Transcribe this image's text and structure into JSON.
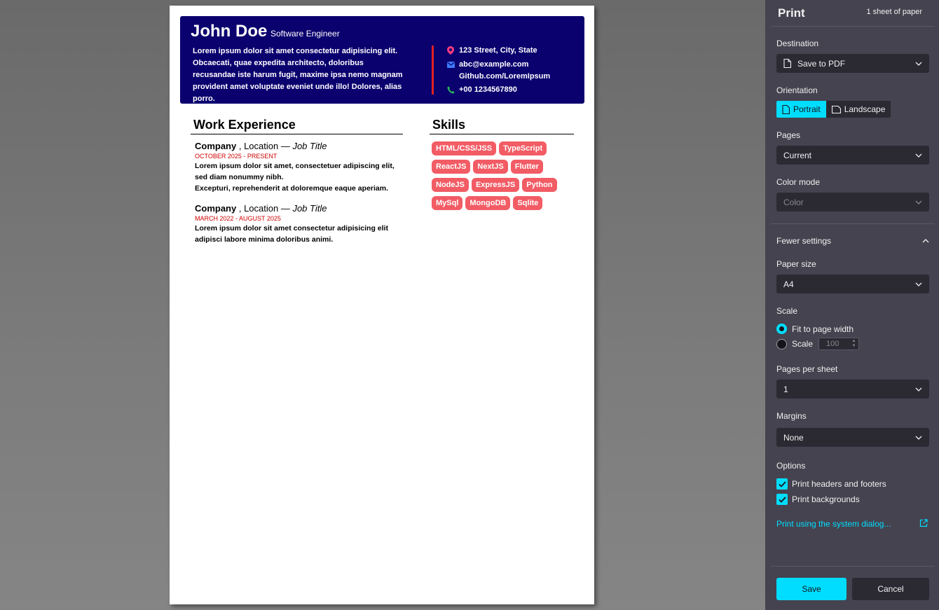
{
  "resume": {
    "name": "John Doe",
    "role": "Software Engineer",
    "summary": "Lorem ipsum dolor sit amet consectetur adipisicing elit. Obcaecati, quae expedita architecto, doloribus recusandae iste harum fugit, maxime ipsa nemo magnam provident amet voluptate eveniet unde illo! Dolores, alias porro.",
    "contact": {
      "address": "123 Street, City, State",
      "email": "abc@example.com",
      "github": "Github.com/LoremIpsum",
      "phone": "+00 1234567890"
    },
    "work_title": "Work Experience",
    "skills_title": "Skills",
    "jobs": [
      {
        "company": "Company",
        "location": " , Location — ",
        "title": "Job Title",
        "dates": "OCTOBER 2025 - PRESENT",
        "desc1": "Lorem ipsum dolor sit amet, consectetuer adipiscing elit, sed diam nonummy nibh.",
        "desc2": "Excepturi, reprehenderit at doloremque eaque aperiam."
      },
      {
        "company": "Company",
        "location": " , Location — ",
        "title": "Job Title",
        "dates": "MARCH 2022 - AUGUST 2025",
        "desc1": "Lorem ipsum dolor sit amet consectetur adipisicing elit adipisci labore minima doloribus animi."
      }
    ],
    "skills": [
      "HTML/CSS/JSS",
      "TypeScript",
      "ReactJS",
      "NextJS",
      "Flutter",
      "NodeJS",
      "ExpressJS",
      "Python",
      "MySql",
      "MongoDB",
      "Sqlite"
    ]
  },
  "print": {
    "title": "Print",
    "sheets": "1 sheet of paper",
    "destination_label": "Destination",
    "destination_value": "Save to PDF",
    "orientation_label": "Orientation",
    "portrait": "Portrait",
    "landscape": "Landscape",
    "pages_label": "Pages",
    "pages_value": "Current",
    "color_label": "Color mode",
    "color_value": "Color",
    "fewer_settings": "Fewer settings",
    "paper_label": "Paper size",
    "paper_value": "A4",
    "scale_label": "Scale",
    "fit_width": "Fit to page width",
    "scale_option": "Scale",
    "scale_value": "100",
    "pps_label": "Pages per sheet",
    "pps_value": "1",
    "margins_label": "Margins",
    "margins_value": "None",
    "options_label": "Options",
    "headers_footers": "Print headers and footers",
    "backgrounds": "Print backgrounds",
    "system_dialog": "Print using the system dialog...",
    "save": "Save",
    "cancel": "Cancel"
  },
  "colors": {
    "accent": "#00ddff",
    "header_bg": "#0a006e",
    "skill_bg": "#f25c65",
    "date_red": "#d00000"
  }
}
